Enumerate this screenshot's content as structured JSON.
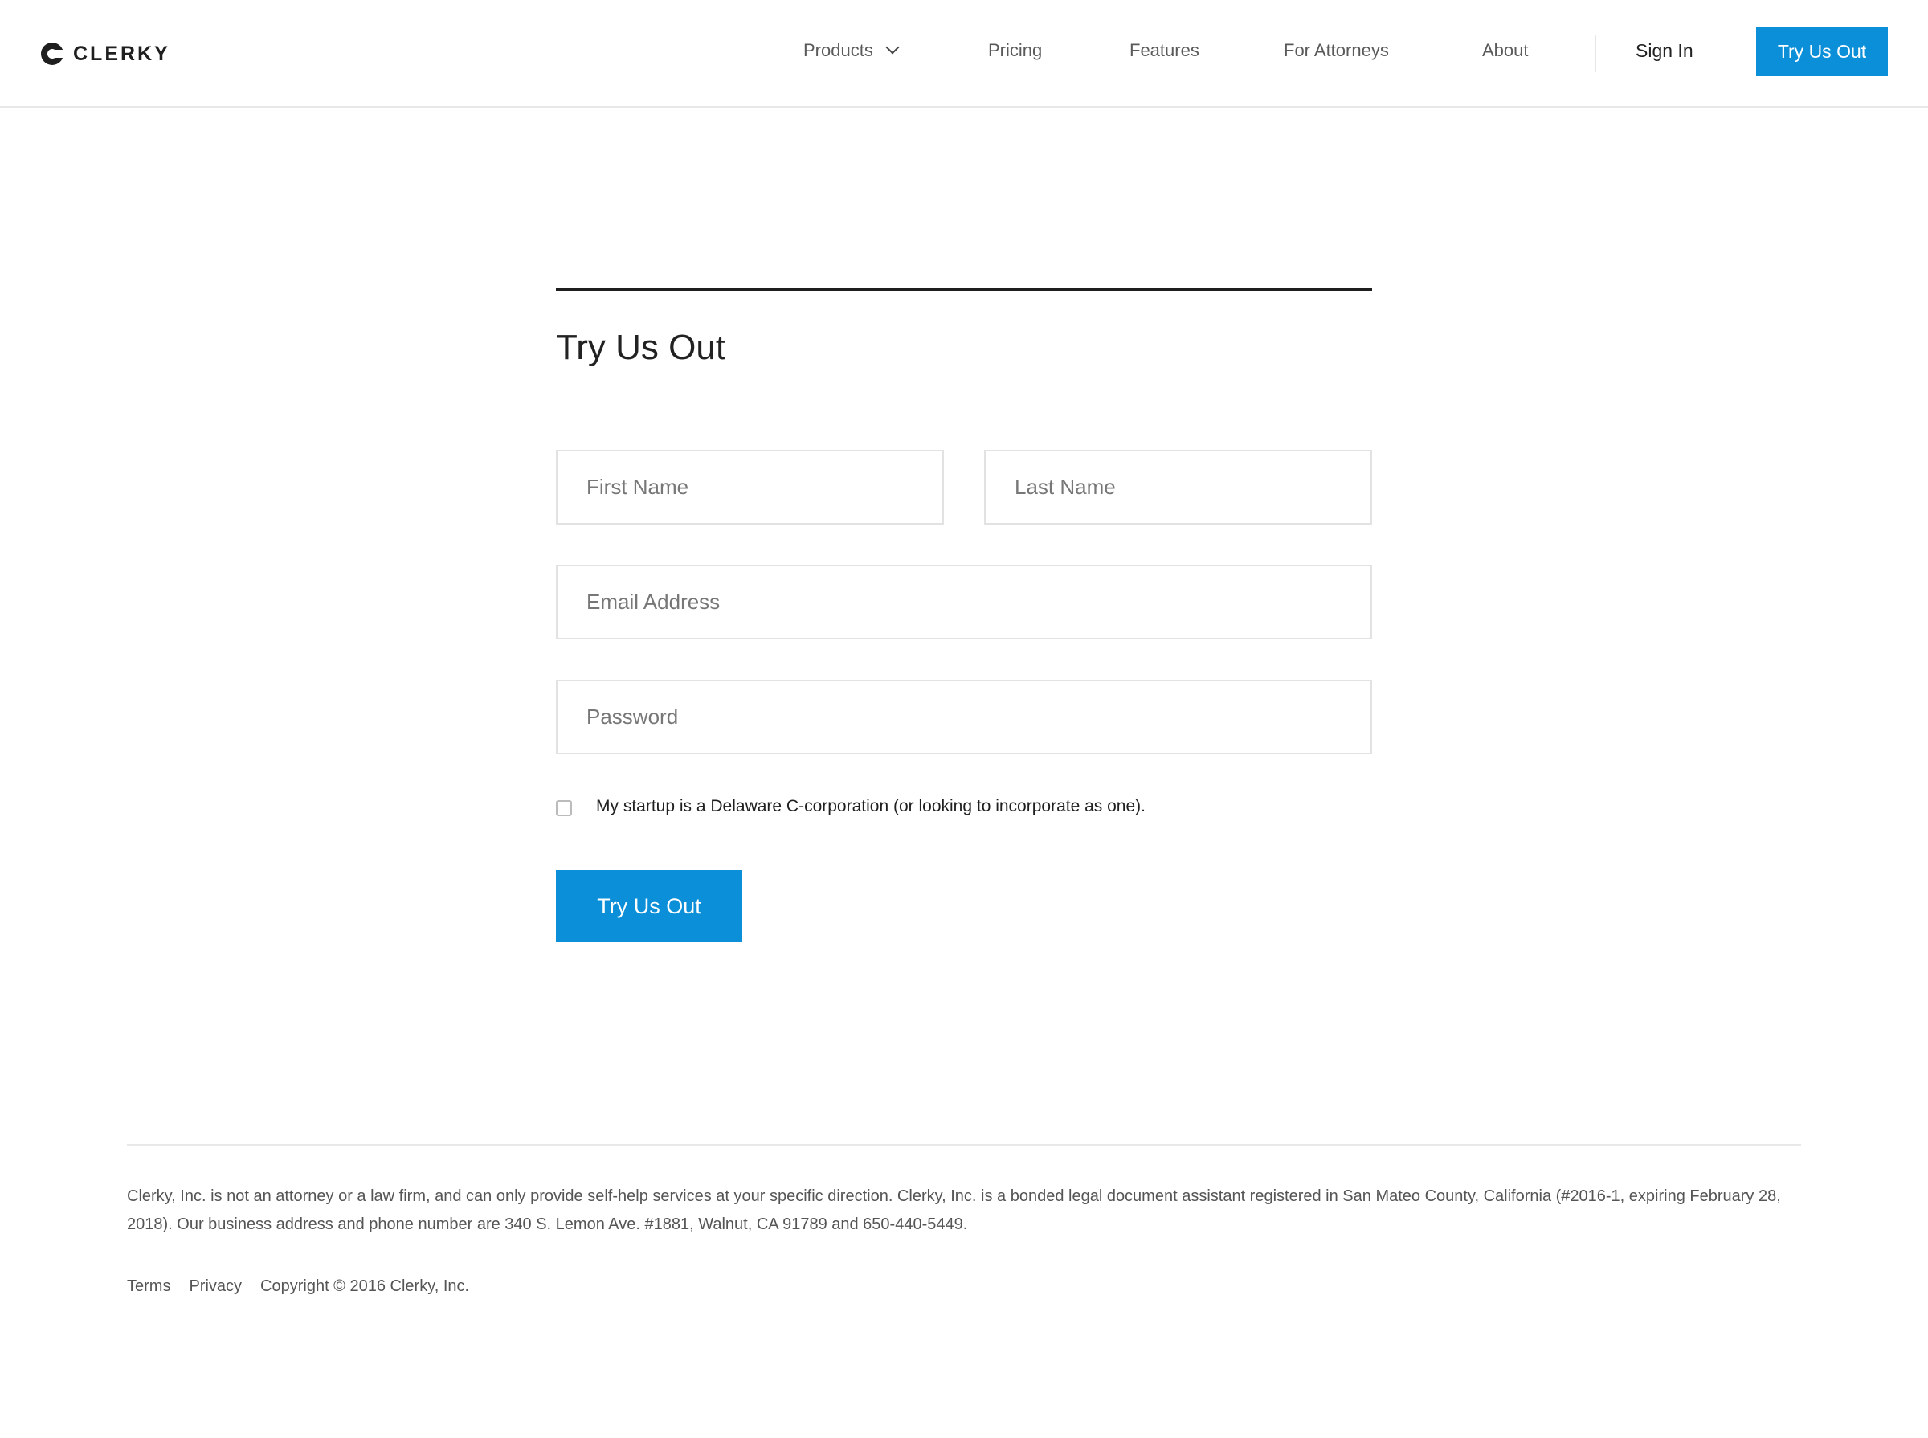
{
  "header": {
    "logo_text": "CLERKY",
    "nav": [
      {
        "label": "Products"
      },
      {
        "label": "Pricing"
      },
      {
        "label": "Features"
      },
      {
        "label": "For Attorneys"
      },
      {
        "label": "About"
      }
    ],
    "sign_in": "Sign In",
    "cta": "Try Us Out"
  },
  "form": {
    "title": "Try Us Out",
    "first_name_placeholder": "First Name",
    "last_name_placeholder": "Last Name",
    "email_placeholder": "Email Address",
    "password_placeholder": "Password",
    "checkbox_label": "My startup is a Delaware C-corporation (or looking to incorporate as one).",
    "checkbox_checked": false,
    "submit_label": "Try Us Out"
  },
  "footer": {
    "disclaimer": "Clerky, Inc. is not an attorney or a law firm, and can only provide self-help services at your specific direction. Clerky, Inc. is a bonded legal document assistant registered in San Mateo County, California (#2016-1, expiring February 28, 2018). Our business address and phone number are 340 S. Lemon Ave. #1881, Walnut, CA 91789 and 650-440-5449.",
    "links": [
      "Terms",
      "Privacy"
    ],
    "copyright": "Copyright © 2016 Clerky, Inc."
  },
  "colors": {
    "accent": "#0b8fd9",
    "text": "#222222",
    "muted": "#555555"
  }
}
